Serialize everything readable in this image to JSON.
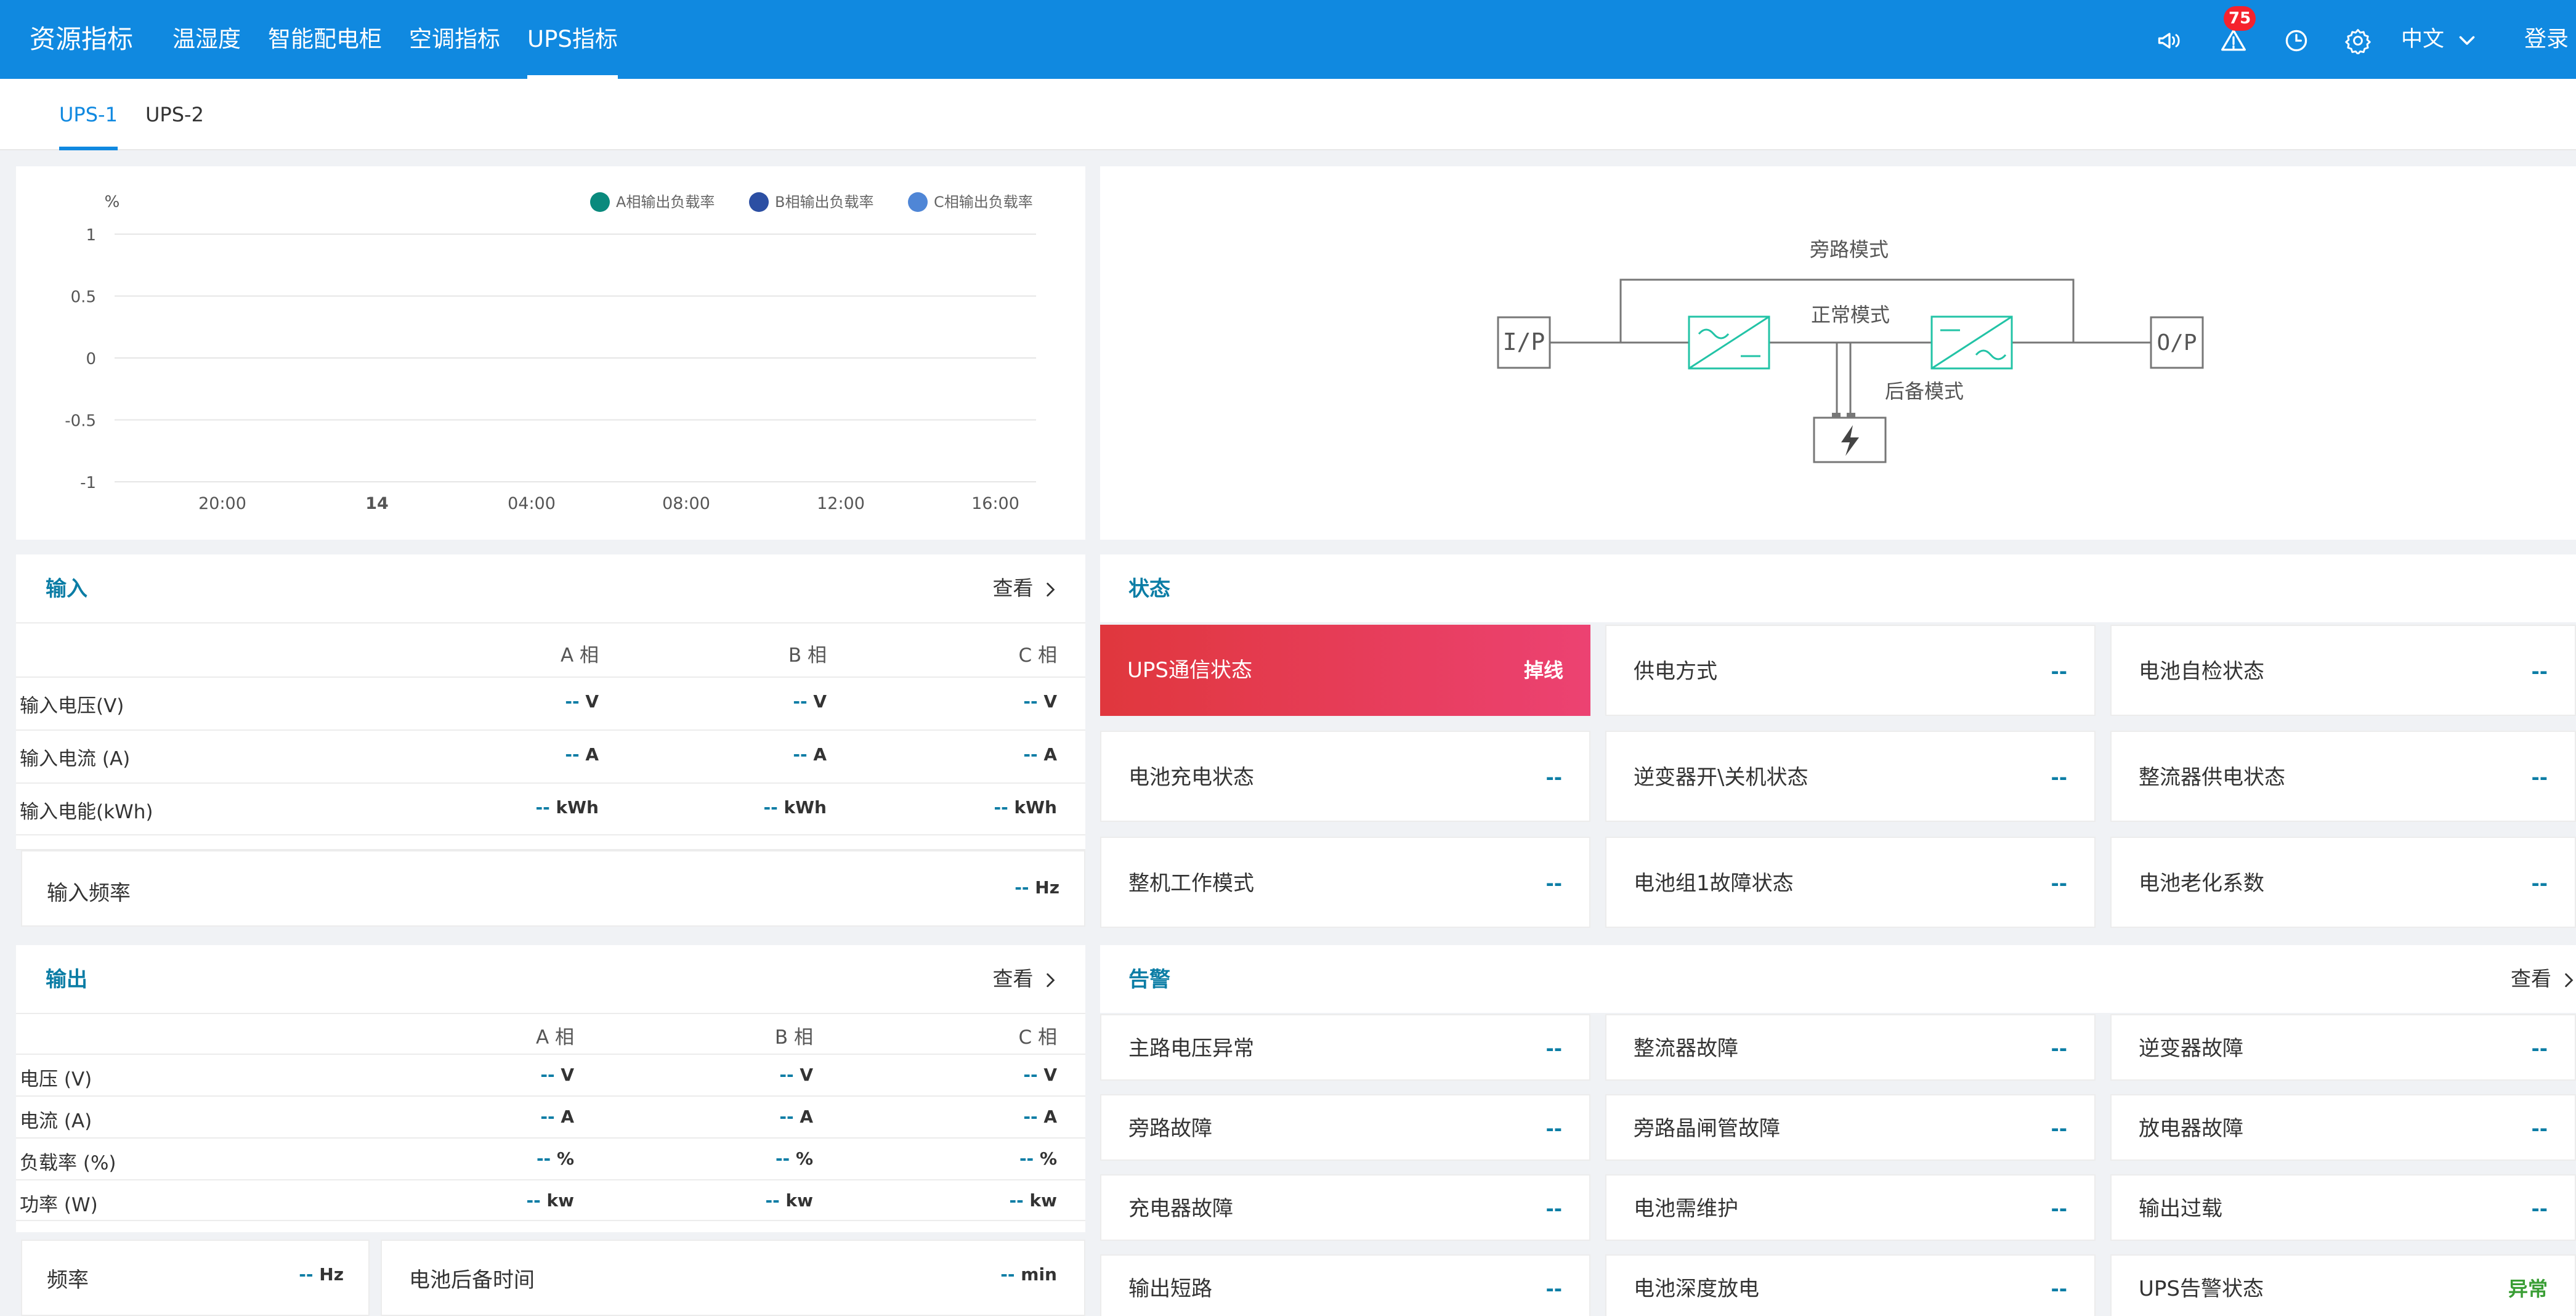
{
  "app": {
    "title": "资源指标"
  },
  "nav": {
    "items": [
      "温湿度",
      "智能配电柜",
      "空调指标",
      "UPS指标"
    ],
    "active": "UPS指标"
  },
  "toolbar": {
    "alert_count": "75",
    "language": "中文",
    "login_label": "登录",
    "icons": [
      "announcement-icon",
      "alert-icon",
      "clock-icon",
      "settings-icon",
      "chevron-down-icon"
    ]
  },
  "tabs": {
    "items": [
      "UPS-1",
      "UPS-2"
    ],
    "active": "UPS-1"
  },
  "chart_data": {
    "type": "line",
    "unit": "%",
    "x": [
      "20:00",
      "14",
      "04:00",
      "08:00",
      "12:00",
      "16:00"
    ],
    "y_ticks": [
      "1",
      "0.5",
      "0",
      "-0.5",
      "-1"
    ],
    "ylim": [
      -1,
      1
    ],
    "series": [
      {
        "name": "A相输出负载率",
        "color": "#0a8a7d",
        "values": []
      },
      {
        "name": "B相输出负载率",
        "color": "#2c4fa3",
        "values": []
      },
      {
        "name": "C相输出负载率",
        "color": "#4f86d6",
        "values": []
      }
    ],
    "legend": "top-right",
    "grid": true
  },
  "diagram": {
    "bypass": "旁路模式",
    "normal": "正常模式",
    "backup": "后备模式",
    "input": "I/P",
    "output": "O/P"
  },
  "input": {
    "title": "输入",
    "view_label": "查看",
    "headers": [
      "A 相",
      "B 相",
      "C 相"
    ],
    "rows": [
      {
        "label": "输入电压(V)",
        "unit": "V"
      },
      {
        "label": "输入电流 (A)",
        "unit": "A"
      },
      {
        "label": "输入电能(kWh)",
        "unit": "kWh"
      }
    ],
    "freq_label": "输入频率",
    "freq_unit": "Hz",
    "empty": "--"
  },
  "output": {
    "title": "输出",
    "view_label": "查看",
    "headers": [
      "A 相",
      "B 相",
      "C 相"
    ],
    "rows": [
      {
        "label": "电压 (V)",
        "unit": "V"
      },
      {
        "label": "电流 (A)",
        "unit": "A"
      },
      {
        "label": "负载率 (%)",
        "unit": "%"
      },
      {
        "label": "功率 (W)",
        "unit": "kw"
      }
    ],
    "freq_label": "频率",
    "freq_unit": "Hz",
    "backup_label": "电池后备时间",
    "backup_unit": "min",
    "empty": "--"
  },
  "status": {
    "title": "状态",
    "cards": [
      {
        "label": "UPS通信状态",
        "value": "掉线",
        "alert": true
      },
      {
        "label": "供电方式",
        "value": "--"
      },
      {
        "label": "电池自检状态",
        "value": "--"
      },
      {
        "label": "电池充电状态",
        "value": "--"
      },
      {
        "label": "逆变器开\\关机状态",
        "value": "--"
      },
      {
        "label": "整流器供电状态",
        "value": "--"
      },
      {
        "label": "整机工作模式",
        "value": "--"
      },
      {
        "label": "电池组1故障状态",
        "value": "--"
      },
      {
        "label": "电池老化系数",
        "value": "--"
      }
    ]
  },
  "alarm": {
    "title": "告警",
    "view_label": "查看",
    "cards": [
      {
        "label": "主路电压异常",
        "value": "--"
      },
      {
        "label": "整流器故障",
        "value": "--"
      },
      {
        "label": "逆变器故障",
        "value": "--"
      },
      {
        "label": "旁路故障",
        "value": "--"
      },
      {
        "label": "旁路晶闸管故障",
        "value": "--"
      },
      {
        "label": "放电器故障",
        "value": "--"
      },
      {
        "label": "充电器故障",
        "value": "--"
      },
      {
        "label": "电池需维护",
        "value": "--"
      },
      {
        "label": "输出过载",
        "value": "--"
      },
      {
        "label": "输出短路",
        "value": "--"
      },
      {
        "label": "电池深度放电",
        "value": "--"
      },
      {
        "label": "UPS告警状态",
        "value": "异常"
      }
    ]
  }
}
